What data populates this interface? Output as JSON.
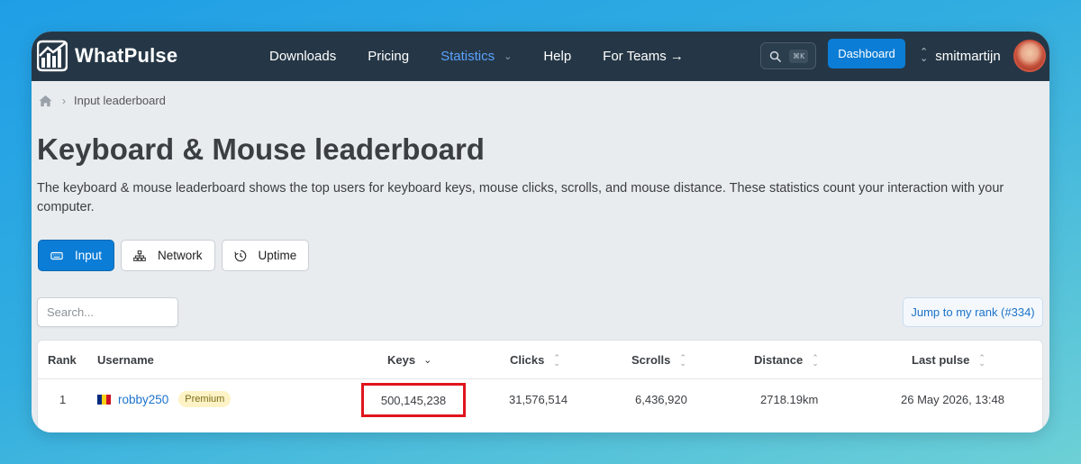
{
  "brand": {
    "name": "WhatPulse"
  },
  "nav": {
    "links": [
      {
        "label": "Downloads"
      },
      {
        "label": "Pricing"
      },
      {
        "label": "Statistics"
      },
      {
        "label": "Help"
      },
      {
        "label": "For Teams →"
      }
    ],
    "search_shortcut": "⌘K",
    "dashboard_label": "Dashboard",
    "username": "smitmartijn"
  },
  "breadcrumb": {
    "current": "Input leaderboard"
  },
  "page": {
    "title": "Keyboard & Mouse leaderboard",
    "description": "The keyboard & mouse leaderboard shows the top users for keyboard keys, mouse clicks, scrolls, and mouse distance. These statistics count your interaction with your computer."
  },
  "tabs": [
    {
      "label": "Input",
      "icon": "keyboard-icon",
      "active": true
    },
    {
      "label": "Network",
      "icon": "network-icon",
      "active": false
    },
    {
      "label": "Uptime",
      "icon": "clock-icon",
      "active": false
    }
  ],
  "search": {
    "placeholder": "Search..."
  },
  "jump_to_rank": "Jump to my rank (#334)",
  "table": {
    "columns": [
      "Rank",
      "Username",
      "Keys",
      "Clicks",
      "Scrolls",
      "Distance",
      "Last pulse"
    ],
    "sorted_column": "Keys",
    "rows": [
      {
        "rank": "1",
        "username": "robby250",
        "flag": "romania-flag",
        "badge": "Premium",
        "keys": "500,145,238",
        "clicks": "31,576,514",
        "scrolls": "6,436,920",
        "distance": "2718.19km",
        "last_pulse": "26 May 2026, 13:48"
      }
    ]
  },
  "colors": {
    "navbar": "#253746",
    "accent": "#0b7dd6",
    "highlight_box": "#e0141e"
  }
}
